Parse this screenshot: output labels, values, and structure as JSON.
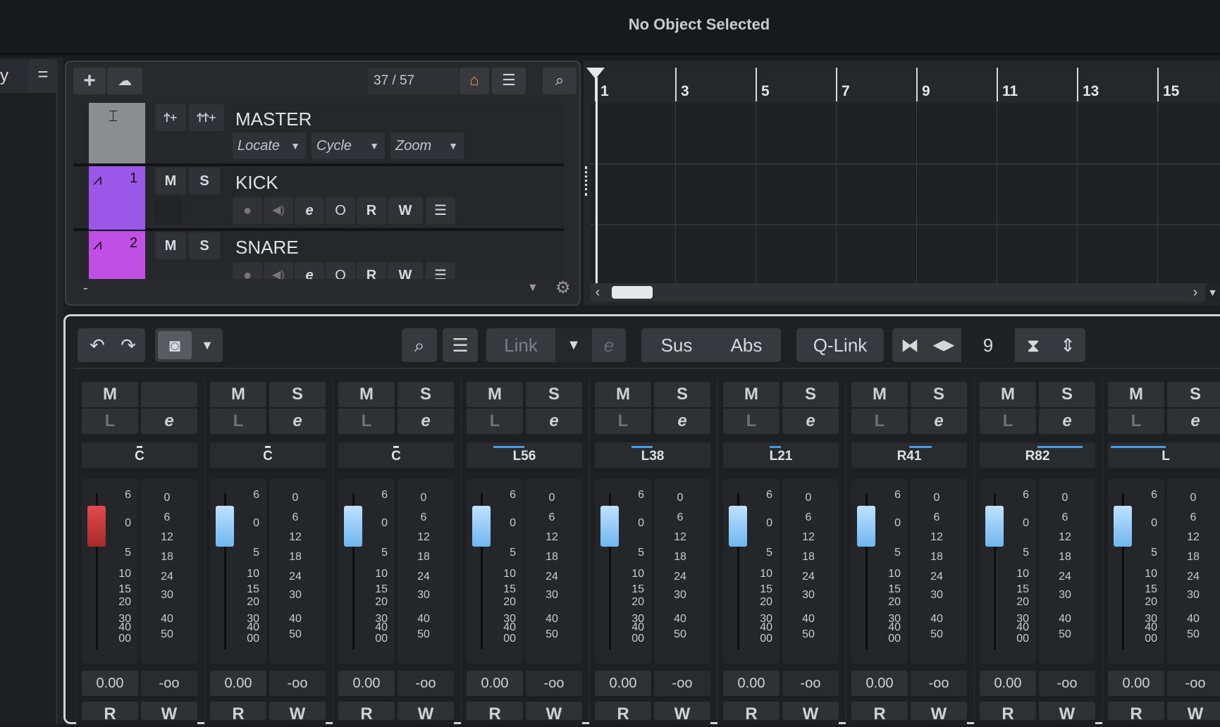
{
  "header": {
    "title": "No Object Selected"
  },
  "left": {
    "tab_label": "y",
    "menu_icon": "="
  },
  "track_panel": {
    "add_icon": "+",
    "cloud_icon": "☁",
    "count": "37 / 57",
    "home_icon": "⌂",
    "list_icon": "☰",
    "search_icon": "⌕",
    "tracks": [
      {
        "name": "MASTER",
        "number": "",
        "color": "#8c8d91",
        "controls": [
          "Locate",
          "Cycle",
          "Zoom"
        ]
      },
      {
        "name": "KICK",
        "number": "1",
        "color": "#9b57e8",
        "m": "M",
        "s": "S",
        "icons": [
          "●",
          "◀)",
          "e",
          "O",
          "R",
          "W",
          "☰"
        ]
      },
      {
        "name": "SNARE",
        "number": "2",
        "color": "#c04fe6",
        "m": "M",
        "s": "S",
        "icons": [
          "●",
          "◀)",
          "e",
          "O",
          "R",
          "W",
          "☰"
        ]
      }
    ],
    "bottom_minus": "-",
    "gear_icon": "⚙",
    "down_icon": "▼"
  },
  "ruler": {
    "bars": [
      "1",
      "3",
      "5",
      "7",
      "9",
      "11",
      "13",
      "15"
    ]
  },
  "mixer": {
    "toolbar": {
      "undo": "↶",
      "redo": "↷",
      "camera": "◙",
      "caret": "▼",
      "search": "⌕",
      "list": "☰",
      "link": "Link",
      "link_caret": "▼",
      "link_e": "e",
      "sus": "Sus",
      "abs": "Abs",
      "qlink": "Q-Link",
      "nav_left": "⧓",
      "nav_lr": "◀▶",
      "value": "9",
      "shrink": "⧗",
      "expand": "⇕"
    },
    "scale_left": [
      "6",
      "0",
      "5",
      "10",
      "15",
      "20",
      "30",
      "40",
      "00"
    ],
    "scale_right": [
      "0",
      "6",
      "12",
      "18",
      "24",
      "30",
      "40",
      "50"
    ],
    "channels": [
      {
        "m": "M",
        "s": "",
        "l": "L",
        "e": "e",
        "pan": "C",
        "pan_value": 0,
        "cap": "red",
        "volume": "0.00",
        "peak": "-oo"
      },
      {
        "m": "M",
        "s": "S",
        "l": "L",
        "e": "e",
        "pan": "C",
        "pan_value": 0,
        "cap": "blue",
        "volume": "0.00",
        "peak": "-oo"
      },
      {
        "m": "M",
        "s": "S",
        "l": "L",
        "e": "e",
        "pan": "C",
        "pan_value": 0,
        "cap": "blue",
        "volume": "0.00",
        "peak": "-oo"
      },
      {
        "m": "M",
        "s": "S",
        "l": "L",
        "e": "e",
        "pan": "L56",
        "pan_value": -56,
        "cap": "blue",
        "volume": "0.00",
        "peak": "-oo"
      },
      {
        "m": "M",
        "s": "S",
        "l": "L",
        "e": "e",
        "pan": "L38",
        "pan_value": -38,
        "cap": "blue",
        "volume": "0.00",
        "peak": "-oo"
      },
      {
        "m": "M",
        "s": "S",
        "l": "L",
        "e": "e",
        "pan": "L21",
        "pan_value": -21,
        "cap": "blue",
        "volume": "0.00",
        "peak": "-oo"
      },
      {
        "m": "M",
        "s": "S",
        "l": "L",
        "e": "e",
        "pan": "R41",
        "pan_value": 41,
        "cap": "blue",
        "volume": "0.00",
        "peak": "-oo"
      },
      {
        "m": "M",
        "s": "S",
        "l": "L",
        "e": "e",
        "pan": "R82",
        "pan_value": 82,
        "cap": "blue",
        "volume": "0.00",
        "peak": "-oo"
      },
      {
        "m": "M",
        "s": "S",
        "l": "L",
        "e": "e",
        "pan": "L",
        "pan_value": -100,
        "cap": "blue",
        "volume": "0.00",
        "peak": "-oo"
      }
    ],
    "row_bottom": [
      "R",
      "W"
    ]
  }
}
